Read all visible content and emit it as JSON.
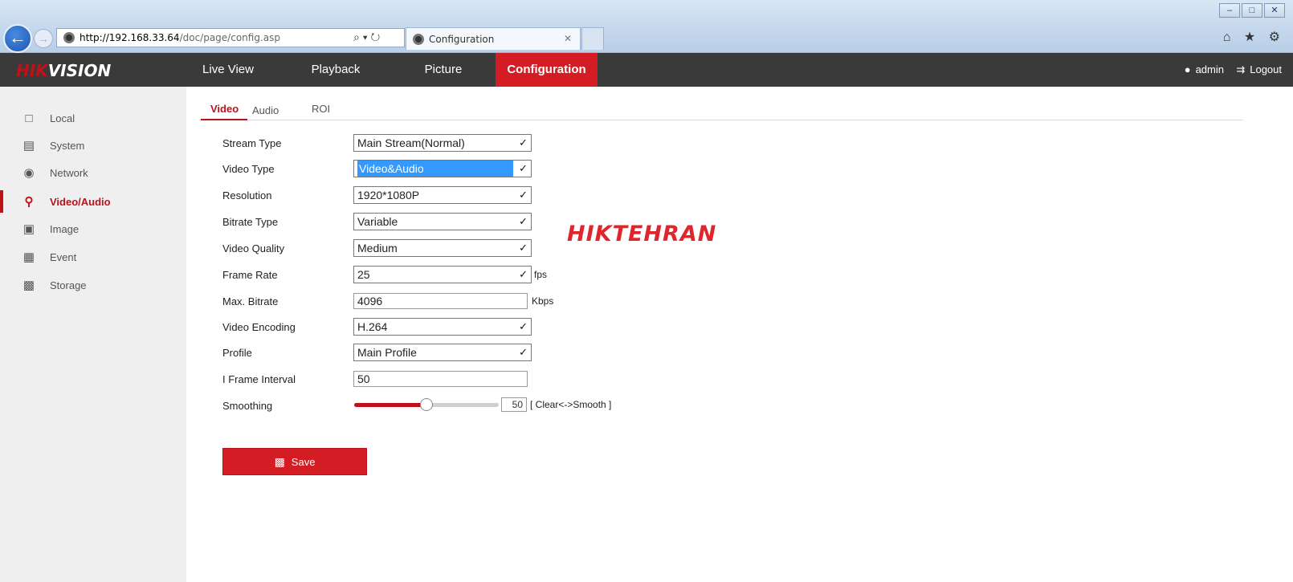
{
  "browser": {
    "url_host": "http://192.168.33.64",
    "url_path": "/doc/page/config.asp",
    "tab_title": "Configuration",
    "search_glyph": "⌕ ▾ ↻",
    "close_glyph": "✕",
    "win_min": "–",
    "win_max": "□",
    "win_close": "✕",
    "toolbar_icons": "⌂ ★ ⚙"
  },
  "header": {
    "logo_part1": "HIK",
    "logo_part2": "VISION",
    "nav": [
      "Live View",
      "Playback",
      "Picture",
      "Configuration"
    ],
    "active_nav": "Configuration",
    "user": "admin",
    "logout": "Logout"
  },
  "sidebar": {
    "items": [
      {
        "label": "Local",
        "icon": "monitor-icon"
      },
      {
        "label": "System",
        "icon": "window-icon"
      },
      {
        "label": "Network",
        "icon": "globe-icon"
      },
      {
        "label": "Video/Audio",
        "icon": "mic-icon"
      },
      {
        "label": "Image",
        "icon": "image-icon"
      },
      {
        "label": "Event",
        "icon": "calendar-icon"
      },
      {
        "label": "Storage",
        "icon": "disk-icon"
      }
    ],
    "active": "Video/Audio"
  },
  "subtabs": [
    "Video",
    "Audio",
    "ROI"
  ],
  "form": {
    "stream_type": {
      "label": "Stream Type",
      "value": "Main Stream(Normal)"
    },
    "video_type": {
      "label": "Video Type",
      "value": "Video&Audio"
    },
    "resolution": {
      "label": "Resolution",
      "value": "1920*1080P"
    },
    "bitrate_type": {
      "label": "Bitrate Type",
      "value": "Variable"
    },
    "video_quality": {
      "label": "Video Quality",
      "value": "Medium"
    },
    "frame_rate": {
      "label": "Frame Rate",
      "value": "25",
      "unit": "fps"
    },
    "max_bitrate": {
      "label": "Max. Bitrate",
      "value": "4096",
      "unit": "Kbps"
    },
    "video_encoding": {
      "label": "Video Encoding",
      "value": "H.264"
    },
    "profile": {
      "label": "Profile",
      "value": "Main Profile"
    },
    "i_frame_interval": {
      "label": "I Frame Interval",
      "value": "50"
    },
    "smoothing": {
      "label": "Smoothing",
      "value": "50",
      "hint": "[ Clear<->Smooth ]",
      "level_fraction": 0.5
    }
  },
  "save_label": "Save",
  "watermark": "HIKTEHRAN",
  "colors": {
    "accent": "#d31c23",
    "header_bg": "#3a3a3a",
    "sidebar_bg": "#efefef"
  }
}
